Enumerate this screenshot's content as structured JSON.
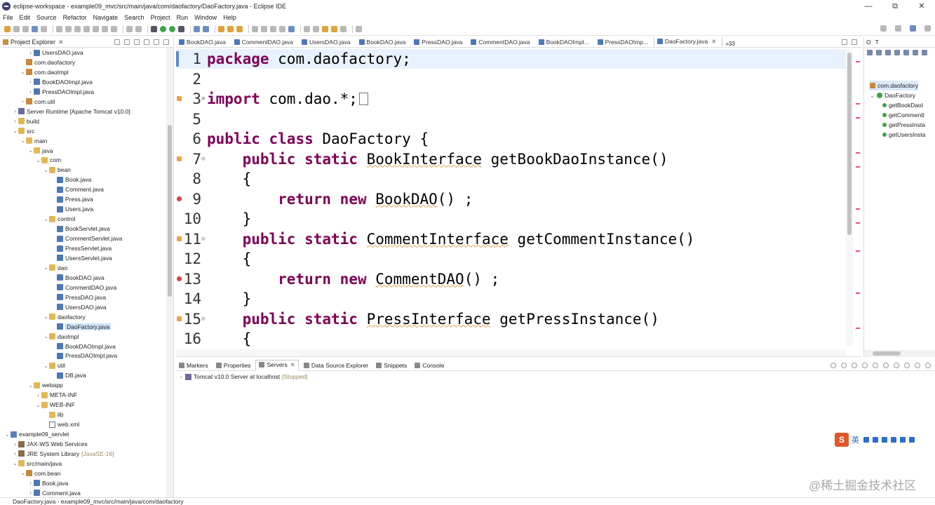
{
  "window": {
    "title": "eclipse-workspace - example09_mvc/src/main/java/com/daofactory/DaoFactory.java - Eclipse IDE",
    "controls": [
      "—",
      "⧉",
      "✕"
    ]
  },
  "menu": [
    "File",
    "Edit",
    "Source",
    "Refactor",
    "Navigate",
    "Search",
    "Project",
    "Run",
    "Window",
    "Help"
  ],
  "explorer": {
    "title": "Project Explorer",
    "items": [
      {
        "label": "UsersDAO.java",
        "indent": 3,
        "icon": "java",
        "twisty": ">"
      },
      {
        "label": "com.daofactory",
        "indent": 2,
        "icon": "package",
        "twisty": ""
      },
      {
        "label": "com.daoImpl",
        "indent": 2,
        "icon": "package",
        "twisty": "v"
      },
      {
        "label": "BookDAOImpl.java",
        "indent": 3,
        "icon": "java",
        "twisty": ">"
      },
      {
        "label": "PressDAOImpl.java",
        "indent": 3,
        "icon": "java",
        "twisty": ">"
      },
      {
        "label": "com.util",
        "indent": 2,
        "icon": "package",
        "twisty": ">"
      },
      {
        "label": "Server Runtime [Apache Tomcat v10.0]",
        "indent": 1,
        "icon": "server",
        "twisty": ">"
      },
      {
        "label": "build",
        "indent": 1,
        "icon": "folder",
        "twisty": ">"
      },
      {
        "label": "src",
        "indent": 1,
        "icon": "folder",
        "twisty": "v"
      },
      {
        "label": "main",
        "indent": 2,
        "icon": "folder",
        "twisty": "v"
      },
      {
        "label": "java",
        "indent": 3,
        "icon": "folder",
        "twisty": "v"
      },
      {
        "label": "com",
        "indent": 4,
        "icon": "folder",
        "twisty": "v"
      },
      {
        "label": "bean",
        "indent": 5,
        "icon": "folder",
        "twisty": "v"
      },
      {
        "label": "Book.java",
        "indent": 6,
        "icon": "java",
        "twisty": ""
      },
      {
        "label": "Comment.java",
        "indent": 6,
        "icon": "java",
        "twisty": ""
      },
      {
        "label": "Press.java",
        "indent": 6,
        "icon": "java",
        "twisty": ""
      },
      {
        "label": "Users.java",
        "indent": 6,
        "icon": "java",
        "twisty": ""
      },
      {
        "label": "control",
        "indent": 5,
        "icon": "folder",
        "twisty": "v"
      },
      {
        "label": "BookServlet.java",
        "indent": 6,
        "icon": "java",
        "twisty": ""
      },
      {
        "label": "CommentServlet.java",
        "indent": 6,
        "icon": "java",
        "twisty": ""
      },
      {
        "label": "PressServlet.java",
        "indent": 6,
        "icon": "java",
        "twisty": ""
      },
      {
        "label": "UsersServlet.java",
        "indent": 6,
        "icon": "java",
        "twisty": ""
      },
      {
        "label": "dao",
        "indent": 5,
        "icon": "folder",
        "twisty": "v"
      },
      {
        "label": "BookDAO.java",
        "indent": 6,
        "icon": "java",
        "twisty": ""
      },
      {
        "label": "CommentDAO.java",
        "indent": 6,
        "icon": "java",
        "twisty": ""
      },
      {
        "label": "PressDAO.java",
        "indent": 6,
        "icon": "java",
        "twisty": ""
      },
      {
        "label": "UsersDAO.java",
        "indent": 6,
        "icon": "java",
        "twisty": ""
      },
      {
        "label": "daofactory",
        "indent": 5,
        "icon": "folder",
        "twisty": "v"
      },
      {
        "label": "DaoFactory.java",
        "indent": 6,
        "icon": "java",
        "twisty": "",
        "selected": true
      },
      {
        "label": "daoImpl",
        "indent": 5,
        "icon": "folder",
        "twisty": "v"
      },
      {
        "label": "BookDAOImpl.java",
        "indent": 6,
        "icon": "java",
        "twisty": ""
      },
      {
        "label": "PressDAOImpl.java",
        "indent": 6,
        "icon": "java",
        "twisty": ""
      },
      {
        "label": "util",
        "indent": 5,
        "icon": "folder",
        "twisty": "v"
      },
      {
        "label": "DB.java",
        "indent": 6,
        "icon": "java",
        "twisty": ""
      },
      {
        "label": "webapp",
        "indent": 3,
        "icon": "folder",
        "twisty": "v"
      },
      {
        "label": "META-INF",
        "indent": 4,
        "icon": "folder",
        "twisty": ">"
      },
      {
        "label": "WEB-INF",
        "indent": 4,
        "icon": "folder",
        "twisty": "v"
      },
      {
        "label": "lib",
        "indent": 5,
        "icon": "folder",
        "twisty": ""
      },
      {
        "label": "web.xml",
        "indent": 5,
        "icon": "xml",
        "twisty": ""
      },
      {
        "label": "example09_servlet",
        "indent": 0,
        "icon": "project",
        "twisty": "v"
      },
      {
        "label": "JAX-WS Web Services",
        "indent": 1,
        "icon": "lib",
        "twisty": ">"
      },
      {
        "label": "JRE System Library",
        "suffix": "[JavaSE-16]",
        "indent": 1,
        "icon": "lib",
        "twisty": ">"
      },
      {
        "label": "src/main/java",
        "indent": 1,
        "icon": "folder",
        "twisty": "v"
      },
      {
        "label": "com.bean",
        "indent": 2,
        "icon": "package",
        "twisty": "v"
      },
      {
        "label": "Book.java",
        "indent": 3,
        "icon": "java",
        "twisty": ">"
      },
      {
        "label": "Comment.java",
        "indent": 3,
        "icon": "java",
        "twisty": ">"
      }
    ]
  },
  "editor_tabs": [
    {
      "label": "BookDAO.java",
      "active": false
    },
    {
      "label": "CommentDAO.java",
      "active": false
    },
    {
      "label": "UsersDAO.java",
      "active": false
    },
    {
      "label": "BookDAO.java",
      "active": false
    },
    {
      "label": "PressDAO.java",
      "active": false
    },
    {
      "label": "CommentDAO.java",
      "active": false
    },
    {
      "label": "BookDAOImpl...",
      "active": false
    },
    {
      "label": "PressDAOImp...",
      "active": false
    },
    {
      "label": "DaoFactory.java",
      "active": true
    }
  ],
  "editor_tabs_more": "»33",
  "code_lines": [
    {
      "num": "1",
      "mark": "",
      "fold": "",
      "html": "<span class=\"kw\">package</span> com.daofactory;"
    },
    {
      "num": "2",
      "mark": "",
      "fold": "",
      "html": ""
    },
    {
      "num": "3",
      "mark": "warn",
      "fold": "⊕",
      "html": "<span class=\"kw\">import</span> com.dao.*;<span class=\"cursor-box\"></span>"
    },
    {
      "num": "5",
      "mark": "",
      "fold": "",
      "html": ""
    },
    {
      "num": "6",
      "mark": "",
      "fold": "",
      "html": "<span class=\"kw\">public</span> <span class=\"kw\">class</span> DaoFactory {"
    },
    {
      "num": "7",
      "mark": "warn",
      "fold": "⊖",
      "html": "    <span class=\"kw\">public</span> <span class=\"kw\">static</span> <span class=\"err\">BookInterface</span> getBookDaoInstance()"
    },
    {
      "num": "8",
      "mark": "",
      "fold": "",
      "html": "    {"
    },
    {
      "num": "9",
      "mark": "err",
      "fold": "",
      "html": "        <span class=\"kw\">return</span> <span class=\"kw\">new</span> <span class=\"err\">BookDAO</span>() ;"
    },
    {
      "num": "10",
      "mark": "",
      "fold": "",
      "html": "    }"
    },
    {
      "num": "11",
      "mark": "warn",
      "fold": "⊖",
      "html": "    <span class=\"kw\">public</span> <span class=\"kw\">static</span> <span class=\"err\">CommentInterface</span> getCommentInstance()"
    },
    {
      "num": "12",
      "mark": "",
      "fold": "",
      "html": "    {"
    },
    {
      "num": "13",
      "mark": "err",
      "fold": "",
      "html": "        <span class=\"kw\">return</span> <span class=\"kw\">new</span> <span class=\"err\">CommentDAO</span>() ;"
    },
    {
      "num": "14",
      "mark": "",
      "fold": "",
      "html": "    }"
    },
    {
      "num": "15",
      "mark": "warn",
      "fold": "⊖",
      "html": "    <span class=\"kw\">public</span> <span class=\"kw\">static</span> <span class=\"err\">PressInterface</span> getPressInstance()"
    },
    {
      "num": "16",
      "mark": "",
      "fold": "",
      "html": "    {"
    }
  ],
  "bottom_tabs": [
    {
      "label": "Markers",
      "active": false
    },
    {
      "label": "Properties",
      "active": false
    },
    {
      "label": "Servers",
      "active": true
    },
    {
      "label": "Data Source Explorer",
      "active": false
    },
    {
      "label": "Snippets",
      "active": false
    },
    {
      "label": "Console",
      "active": false
    }
  ],
  "server": {
    "name": "Tomcat v10.0 Server at localhost",
    "state": "[Stopped]"
  },
  "outline": {
    "tabs": [
      "O",
      "T"
    ],
    "items": [
      {
        "label": "com.daofactory",
        "indent": 1,
        "icon": "pkg",
        "selected": true
      },
      {
        "label": "DaoFactory",
        "indent": 1,
        "icon": "class",
        "twisty": "v"
      },
      {
        "label": "getBookDaoI",
        "indent": 2,
        "icon": "method"
      },
      {
        "label": "getCommentI",
        "indent": 2,
        "icon": "method"
      },
      {
        "label": "getPressInsta",
        "indent": 2,
        "icon": "method"
      },
      {
        "label": "getUsersInsta",
        "indent": 2,
        "icon": "method"
      }
    ]
  },
  "ime": {
    "lang": "英"
  },
  "watermark": "@稀土掘金技术社区",
  "status": "DaoFactory.java - example09_mvc/src/main/java/com/daofactory"
}
